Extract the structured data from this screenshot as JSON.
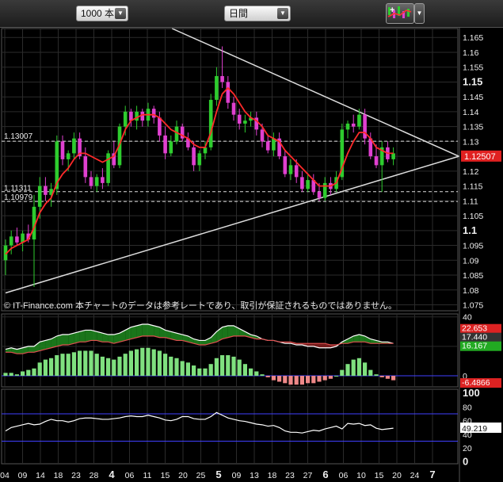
{
  "toolbar": {
    "bars_select": "1000 本",
    "period_select": "日間",
    "tools_icon": "chart-tools-icon"
  },
  "colors": {
    "up": "#2ecc2e",
    "down": "#e040d0",
    "ma": "#ff2a2a",
    "trend": "#dcdcdc",
    "grid": "#2b2b2b",
    "last_bg": "#e02020",
    "hist_pos": "#7fe07f",
    "hist_neg": "#ee8888",
    "zero_line": "#4040ff"
  },
  "chart_data": [
    {
      "type": "candlestick",
      "title": "",
      "copyright": "© IT-Finance.com 本チャートのデータは参考レートであり、取引が保証されるものではありません。",
      "ylim": [
        1.073,
        1.168
      ],
      "y_ticks": [
        "1.165",
        "1.16",
        "1.155",
        "1.15",
        "1.145",
        "1.14",
        "1.135",
        "1.13",
        "1.125",
        "1.12",
        "1.115",
        "1.11",
        "1.105",
        "1.1",
        "1.095",
        "1.09",
        "1.085",
        "1.08",
        "1.075"
      ],
      "y_ticks_bold": [
        "1.15",
        "1.1"
      ],
      "x_ticks": [
        "04",
        "09",
        "14",
        "18",
        "23",
        "28",
        "4",
        "06",
        "11",
        "15",
        "20",
        "25",
        "5",
        "09",
        "13",
        "18",
        "23",
        "27",
        "6",
        "06",
        "10",
        "15",
        "20",
        "24",
        "7"
      ],
      "x_ticks_bold": [
        "4",
        "5",
        "6",
        "7"
      ],
      "last_price": "1.12507",
      "level_lines": [
        {
          "label": "1.13007",
          "value": 1.13007
        },
        {
          "label": "1.11311",
          "value": 1.11311
        },
        {
          "label": "1.10979",
          "value": 1.10979
        }
      ],
      "candles": [
        [
          1.09,
          1.097,
          1.085,
          1.095
        ],
        [
          1.095,
          1.1,
          1.092,
          1.098
        ],
        [
          1.098,
          1.101,
          1.095,
          1.096
        ],
        [
          1.096,
          1.1,
          1.093,
          1.099
        ],
        [
          1.099,
          1.102,
          1.096,
          1.097
        ],
        [
          1.097,
          1.112,
          1.081,
          1.108
        ],
        [
          1.108,
          1.118,
          1.104,
          1.115
        ],
        [
          1.115,
          1.118,
          1.11,
          1.112
        ],
        [
          1.112,
          1.116,
          1.108,
          1.114
        ],
        [
          1.114,
          1.132,
          1.112,
          1.13
        ],
        [
          1.13,
          1.132,
          1.122,
          1.124
        ],
        [
          1.124,
          1.127,
          1.12,
          1.126
        ],
        [
          1.126,
          1.133,
          1.124,
          1.131
        ],
        [
          1.131,
          1.133,
          1.124,
          1.125
        ],
        [
          1.125,
          1.128,
          1.116,
          1.118
        ],
        [
          1.118,
          1.12,
          1.114,
          1.115
        ],
        [
          1.115,
          1.119,
          1.113,
          1.118
        ],
        [
          1.118,
          1.121,
          1.114,
          1.116
        ],
        [
          1.116,
          1.127,
          1.115,
          1.126
        ],
        [
          1.126,
          1.13,
          1.121,
          1.122
        ],
        [
          1.122,
          1.136,
          1.121,
          1.135
        ],
        [
          1.135,
          1.142,
          1.132,
          1.14
        ],
        [
          1.14,
          1.141,
          1.135,
          1.137
        ],
        [
          1.137,
          1.142,
          1.134,
          1.14
        ],
        [
          1.14,
          1.141,
          1.135,
          1.137
        ],
        [
          1.137,
          1.143,
          1.135,
          1.141
        ],
        [
          1.141,
          1.142,
          1.136,
          1.138
        ],
        [
          1.138,
          1.14,
          1.13,
          1.132
        ],
        [
          1.132,
          1.135,
          1.124,
          1.126
        ],
        [
          1.126,
          1.132,
          1.125,
          1.13
        ],
        [
          1.13,
          1.137,
          1.129,
          1.135
        ],
        [
          1.135,
          1.136,
          1.13,
          1.131
        ],
        [
          1.131,
          1.133,
          1.127,
          1.128
        ],
        [
          1.128,
          1.13,
          1.12,
          1.122
        ],
        [
          1.122,
          1.127,
          1.12,
          1.126
        ],
        [
          1.126,
          1.13,
          1.124,
          1.128
        ],
        [
          1.128,
          1.146,
          1.127,
          1.144
        ],
        [
          1.144,
          1.155,
          1.142,
          1.152
        ],
        [
          1.152,
          1.162,
          1.148,
          1.15
        ],
        [
          1.15,
          1.152,
          1.141,
          1.143
        ],
        [
          1.143,
          1.145,
          1.137,
          1.139
        ],
        [
          1.139,
          1.141,
          1.134,
          1.136
        ],
        [
          1.136,
          1.139,
          1.133,
          1.137
        ],
        [
          1.137,
          1.14,
          1.135,
          1.138
        ],
        [
          1.138,
          1.14,
          1.132,
          1.134
        ],
        [
          1.134,
          1.136,
          1.128,
          1.13
        ],
        [
          1.13,
          1.132,
          1.126,
          1.127
        ],
        [
          1.127,
          1.133,
          1.125,
          1.131
        ],
        [
          1.131,
          1.133,
          1.124,
          1.125
        ],
        [
          1.125,
          1.127,
          1.118,
          1.119
        ],
        [
          1.119,
          1.124,
          1.117,
          1.122
        ],
        [
          1.122,
          1.124,
          1.116,
          1.118
        ],
        [
          1.118,
          1.12,
          1.113,
          1.114
        ],
        [
          1.114,
          1.119,
          1.113,
          1.117
        ],
        [
          1.117,
          1.119,
          1.112,
          1.113
        ],
        [
          1.113,
          1.116,
          1.11,
          1.111
        ],
        [
          1.111,
          1.118,
          1.11,
          1.116
        ],
        [
          1.116,
          1.118,
          1.112,
          1.114
        ],
        [
          1.114,
          1.12,
          1.113,
          1.118
        ],
        [
          1.118,
          1.136,
          1.117,
          1.134
        ],
        [
          1.134,
          1.137,
          1.131,
          1.136
        ],
        [
          1.136,
          1.139,
          1.133,
          1.135
        ],
        [
          1.135,
          1.141,
          1.134,
          1.139
        ],
        [
          1.139,
          1.141,
          1.129,
          1.131
        ],
        [
          1.131,
          1.133,
          1.124,
          1.125
        ],
        [
          1.125,
          1.129,
          1.121,
          1.122
        ],
        [
          1.122,
          1.13,
          1.113,
          1.128
        ],
        [
          1.128,
          1.13,
          1.123,
          1.124
        ],
        [
          1.124,
          1.128,
          1.122,
          1.126
        ]
      ],
      "ma": [
        1.092,
        1.094,
        1.095,
        1.096,
        1.097,
        1.101,
        1.106,
        1.109,
        1.111,
        1.116,
        1.119,
        1.121,
        1.124,
        1.126,
        1.126,
        1.125,
        1.124,
        1.123,
        1.124,
        1.125,
        1.129,
        1.134,
        1.137,
        1.138,
        1.139,
        1.139,
        1.139,
        1.138,
        1.136,
        1.134,
        1.133,
        1.132,
        1.131,
        1.129,
        1.128,
        1.128,
        1.133,
        1.14,
        1.146,
        1.148,
        1.146,
        1.143,
        1.14,
        1.138,
        1.137,
        1.135,
        1.132,
        1.131,
        1.13,
        1.127,
        1.125,
        1.123,
        1.121,
        1.119,
        1.117,
        1.115,
        1.115,
        1.115,
        1.116,
        1.121,
        1.126,
        1.13,
        1.133,
        1.133,
        1.131,
        1.128,
        1.127,
        1.126,
        1.126
      ]
    },
    {
      "type": "histogram",
      "title": "",
      "ylim": [
        -7.5,
        42
      ],
      "y_ticks": [
        "40",
        "20",
        "0"
      ],
      "readouts": [
        "22.653",
        "17.440",
        "16.167",
        "-6.4866"
      ],
      "readout_colors": [
        "#dd2222",
        "#333333",
        "#22aa22",
        "#dd2222"
      ],
      "line_a": [
        18,
        19,
        18,
        19,
        20,
        20,
        23,
        24,
        25,
        27,
        28,
        28,
        29,
        30,
        31,
        31,
        30,
        29,
        28,
        28,
        29,
        31,
        33,
        34,
        35,
        35,
        34,
        33,
        31,
        30,
        29,
        28,
        27,
        25,
        24,
        24,
        26,
        30,
        33,
        34,
        34,
        32,
        30,
        28,
        27,
        25,
        24,
        24,
        23,
        22,
        22,
        21,
        21,
        20,
        20,
        19,
        19,
        19,
        20,
        23,
        25,
        27,
        28,
        27,
        25,
        24,
        23,
        23,
        22
      ],
      "line_b": [
        16,
        16,
        15,
        15,
        16,
        16,
        17,
        18,
        19,
        20,
        21,
        21,
        22,
        23,
        23,
        24,
        24,
        23,
        23,
        22,
        23,
        24,
        25,
        26,
        27,
        27,
        27,
        26,
        26,
        25,
        24,
        24,
        23,
        22,
        21,
        21,
        22,
        23,
        25,
        26,
        27,
        27,
        27,
        26,
        25,
        25,
        24,
        24,
        23,
        23,
        23,
        22,
        22,
        22,
        22,
        22,
        22,
        21,
        21,
        22,
        22,
        23,
        23,
        23,
        22,
        22,
        22,
        22,
        22
      ],
      "hist": [
        2,
        2,
        1,
        3,
        4,
        5,
        9,
        11,
        12,
        14,
        15,
        15,
        16,
        17,
        17,
        17,
        15,
        13,
        12,
        11,
        13,
        15,
        17,
        18,
        19,
        19,
        18,
        17,
        15,
        13,
        12,
        10,
        9,
        7,
        5,
        5,
        8,
        12,
        14,
        14,
        13,
        11,
        8,
        5,
        3,
        1,
        -1,
        -3,
        -4,
        -5,
        -6,
        -6,
        -6,
        -5,
        -5,
        -4,
        -3,
        -2,
        0,
        4,
        8,
        11,
        12,
        9,
        4,
        1,
        -1,
        -2,
        -3
      ]
    },
    {
      "type": "line",
      "title": "",
      "ylim": [
        -3,
        106
      ],
      "y_ticks": [
        "100",
        "80",
        "60",
        "40",
        "20",
        "0"
      ],
      "y_ticks_bold": [
        "100",
        "0"
      ],
      "readout": "49.219",
      "values": [
        45,
        50,
        52,
        54,
        56,
        54,
        55,
        59,
        62,
        60,
        60,
        58,
        60,
        63,
        64,
        64,
        63,
        62,
        62,
        63,
        64,
        66,
        67,
        66,
        66,
        68,
        66,
        64,
        61,
        60,
        62,
        66,
        66,
        63,
        62,
        62,
        66,
        72,
        68,
        64,
        62,
        60,
        59,
        57,
        55,
        54,
        52,
        53,
        50,
        45,
        43,
        43,
        42,
        44,
        46,
        45,
        48,
        50,
        52,
        48,
        56,
        55,
        56,
        53,
        54,
        49,
        47,
        48,
        49
      ]
    }
  ]
}
